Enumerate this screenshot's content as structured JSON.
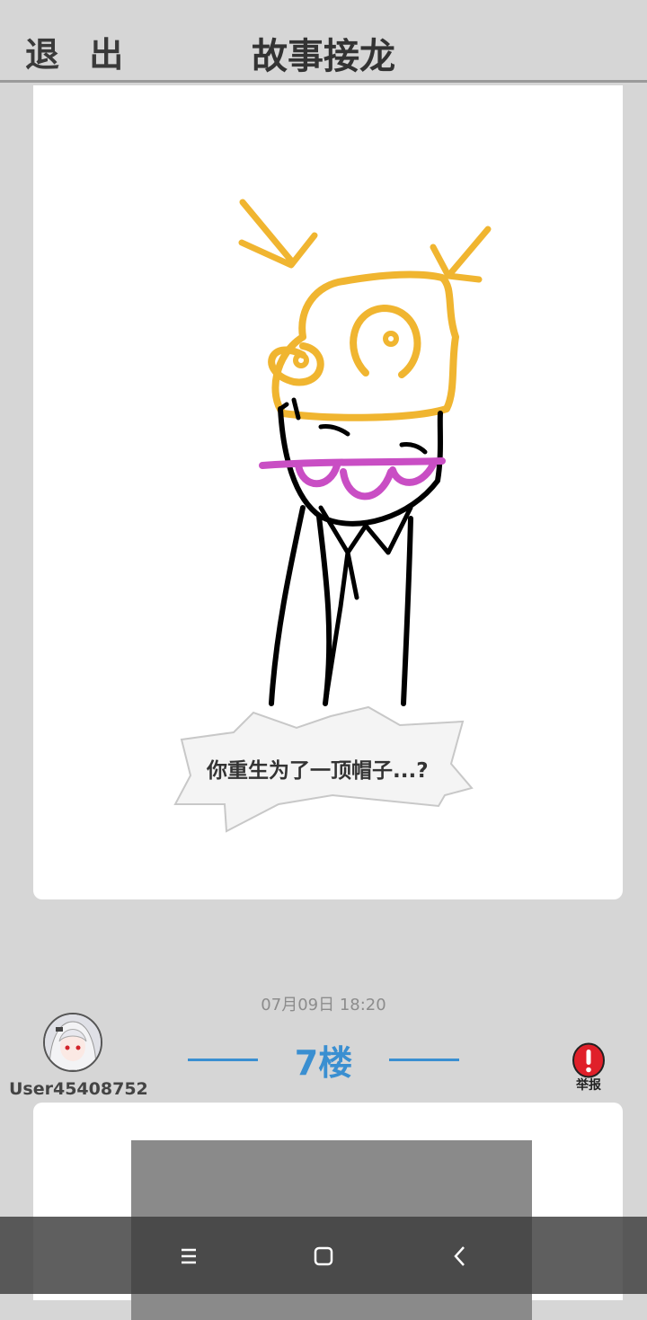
{
  "header": {
    "exit_label": "退 出",
    "title": "故事接龙"
  },
  "post1": {
    "caption": "你重生为了一顶帽子...?"
  },
  "post2": {
    "timestamp": "07月09日  18:20",
    "username": "User45408752",
    "floor": "7楼",
    "report_label": "举报"
  },
  "colors": {
    "accent": "#3a8fd1",
    "report_red": "#e0202a",
    "hat_orange": "#f0b530",
    "glasses_magenta": "#c94ec4"
  },
  "icons": {
    "avatar": "anime-avatar",
    "report": "exclamation-circle-icon",
    "nav": [
      "menu-icon",
      "home-square-icon",
      "back-chevron-icon"
    ]
  }
}
